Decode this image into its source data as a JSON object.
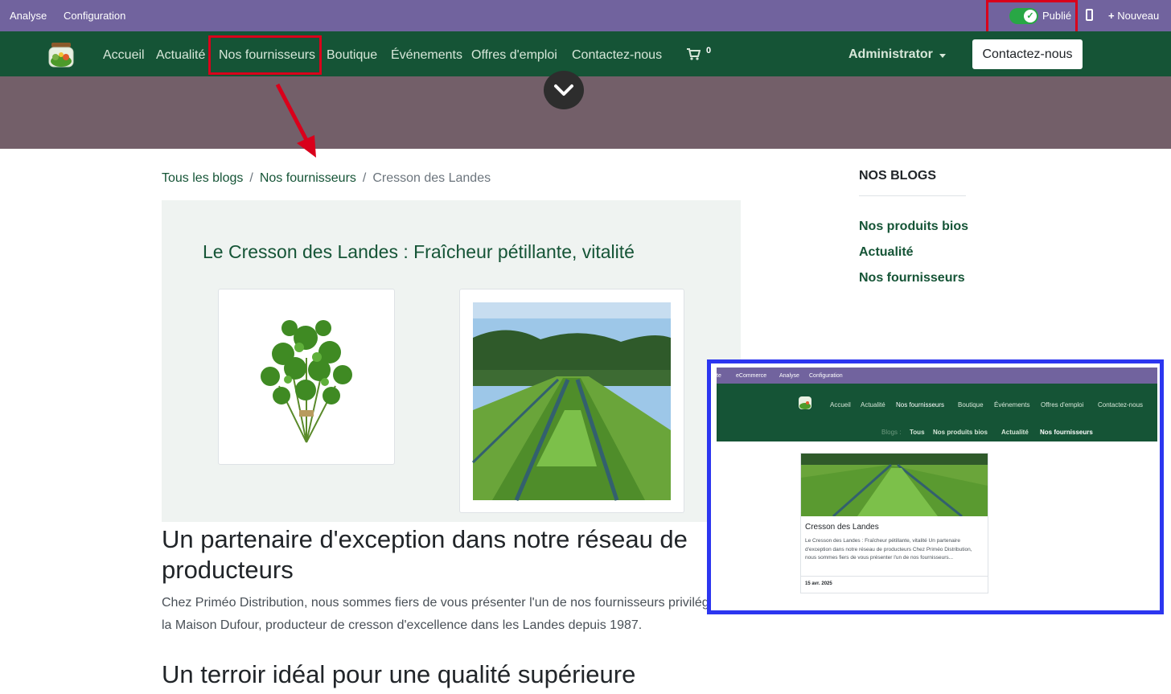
{
  "admin_bar": {
    "menu": [
      "Analyse",
      "Configuration"
    ],
    "publish_label": "Publié",
    "new_label": "Nouveau"
  },
  "nav": {
    "links": [
      "Accueil",
      "Actualité",
      "Nos fournisseurs",
      "Boutique",
      "Événements",
      "Offres d'emploi",
      "Contactez-nous"
    ],
    "cart_count": "0",
    "user": "Administrator",
    "cta": "Contactez-nous"
  },
  "breadcrumb": {
    "items": [
      "Tous les blogs",
      "Nos fournisseurs"
    ],
    "separator": "/",
    "current": "Cresson des Landes"
  },
  "article": {
    "title": "Le Cresson des Landes : Fraîcheur pétillante, vitalité",
    "heading1": "Un partenaire d'exception dans notre réseau de producteurs",
    "paragraph1": "Chez Priméo Distribution, nous sommes fiers de vous présenter l'un de nos fournisseurs privilégiés : la Maison Dufour, producteur de cresson d'excellence dans les Landes depuis 1987.",
    "heading2": "Un terroir idéal pour une qualité supérieure"
  },
  "sidebar": {
    "title": "NOS BLOGS",
    "links": [
      "Nos produits bios",
      "Actualité",
      "Nos fournisseurs"
    ]
  },
  "inset": {
    "top_menu": [
      "te",
      "eCommerce",
      "Analyse",
      "Configuration"
    ],
    "nav_links": [
      "Accueil",
      "Actualité",
      "Nos fournisseurs",
      "Boutique",
      "Événements",
      "Offres d'emploi",
      "Contactez-nous"
    ],
    "blogs_label": "Blogs :",
    "blog_tabs": [
      "Tous",
      "Nos produits bios",
      "Actualité",
      "Nos fournisseurs"
    ],
    "card_title": "Cresson des Landes",
    "card_text": "Le Cresson des Landes : Fraîcheur pétillante, vitalité Un partenaire d'exception dans notre réseau de producteurs Chez Priméo Distribution, nous sommes fiers de vous présenter l'un de nos fournisseurs...",
    "card_date": "15 avr. 2025"
  },
  "icons": {
    "cart": "shopping-cart-icon",
    "check": "check-icon",
    "mobile": "mobile-icon",
    "plus": "plus-icon",
    "chevron": "chevron-down-icon"
  },
  "colors": {
    "admin_bar": "#71639e",
    "nav_bg": "#155436",
    "cover": "#735f69",
    "highlight": "#d9001b",
    "inset_border": "#2c36f0",
    "article_bg": "#eff3f1"
  }
}
